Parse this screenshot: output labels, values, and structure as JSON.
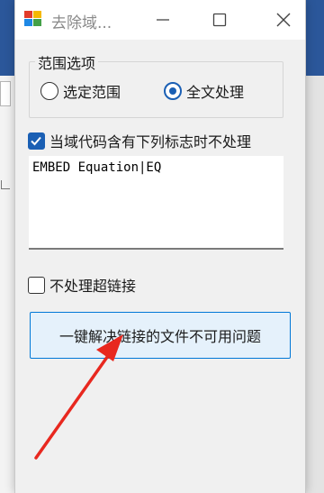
{
  "dialog": {
    "title": "去除域...",
    "scope_group": {
      "title": "范围选项",
      "options": [
        {
          "label": "选定范围",
          "selected": false
        },
        {
          "label": "全文处理",
          "selected": true
        }
      ]
    },
    "skip_fields_checkbox": {
      "label": "当域代码含有下列标志时不处理",
      "checked": true
    },
    "flags_text": "EMBED Equation|EQ",
    "skip_hyperlinks_checkbox": {
      "label": "不处理超链接",
      "checked": false
    },
    "fix_links_button": {
      "label": "一键解决链接的文件不可用问题"
    }
  },
  "colors": {
    "accent": "#1a5fb4",
    "button_border": "#0078d7",
    "button_bg": "#e5f1fb",
    "arrow": "#e8281f",
    "background_app": "#2b579a"
  },
  "icons": [
    "app-icon",
    "minimize-icon",
    "maximize-icon",
    "close-icon",
    "checkmark-icon",
    "pointer-arrow-icon"
  ]
}
